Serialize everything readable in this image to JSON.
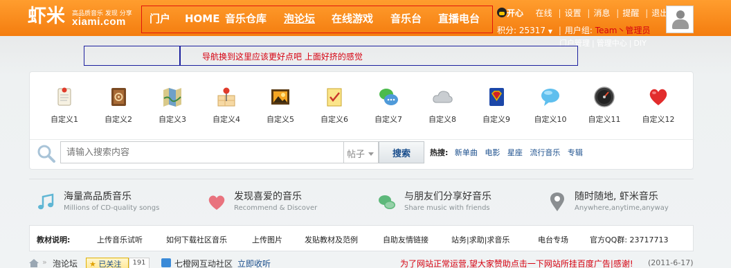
{
  "colors": {
    "brand_orange": "#f47d0f",
    "accent_red": "#e0140d",
    "link_blue": "#1a4e8c",
    "notice_red": "#d6000f"
  },
  "header": {
    "logo": {
      "main": "虾米",
      "tagline": "高品质音乐 发现 分享",
      "domain": "xiami.com"
    },
    "nav": [
      "门户",
      "HOME",
      "音乐仓库",
      "泡论坛",
      "在线游戏",
      "音乐台",
      "直播电台"
    ],
    "active_nav": "泡论坛",
    "user": {
      "name": "开心",
      "links": [
        "在线",
        "设置",
        "消息",
        "提醒",
        "退出"
      ],
      "score_label": "积分: 25317",
      "group_label": "用户组:",
      "group_value": "Team丶管理员"
    },
    "admin_links": [
      "门户管理",
      "管理中心",
      "DIY"
    ]
  },
  "notice": {
    "text": "导航换到这里应该更好点吧  上面好挤的感觉"
  },
  "icons": [
    {
      "label": "自定义1",
      "icon": "memo-pin-icon"
    },
    {
      "label": "自定义2",
      "icon": "address-book-icon"
    },
    {
      "label": "自定义3",
      "icon": "map-icon"
    },
    {
      "label": "自定义4",
      "icon": "map-pin-icon"
    },
    {
      "label": "自定义5",
      "icon": "picture-icon"
    },
    {
      "label": "自定义6",
      "icon": "checklist-icon"
    },
    {
      "label": "自定义7",
      "icon": "chat-bubbles-icon"
    },
    {
      "label": "自定义8",
      "icon": "cloud-icon"
    },
    {
      "label": "自定义9",
      "icon": "superman-book-icon"
    },
    {
      "label": "自定义10",
      "icon": "speech-bubble-icon"
    },
    {
      "label": "自定义11",
      "icon": "gauge-icon"
    },
    {
      "label": "自定义12",
      "icon": "heart-icon"
    }
  ],
  "search": {
    "placeholder": "请输入搜索内容",
    "type_selected": "帖子",
    "button": "搜索",
    "hot_label": "热搜:",
    "hot_links": [
      "新单曲",
      "电影",
      "星座",
      "流行音乐",
      "专辑"
    ]
  },
  "features": [
    {
      "title": "海量高品质音乐",
      "subtitle": "Millions of CD-quality songs",
      "icon": "music-note-icon",
      "color": "#5fb6d4"
    },
    {
      "title": "发现喜爱的音乐",
      "subtitle": "Recommend & Discover",
      "icon": "heart-icon",
      "color": "#e9737e"
    },
    {
      "title": "与朋友们分享好音乐",
      "subtitle": "Share music with friends",
      "icon": "chat-icon",
      "color": "#5db87a"
    },
    {
      "title": "随时随地, 虾米音乐",
      "subtitle": "Anywhere,anytime,anyway",
      "icon": "location-icon",
      "color": "#8a8e91"
    }
  ],
  "tutorial": {
    "label": "教材说明:",
    "links": [
      "上传音乐试听",
      "如何下载社区音乐",
      "上传图片",
      "发贴教材及范例",
      "自助友情链接",
      "站务|求助|求音乐",
      "电台专场",
      "官方QQ群: 23717713"
    ]
  },
  "bottom": {
    "breadcrumb_sep": "»",
    "breadcrumb": "泡论坛",
    "follow_label": "已关注",
    "follow_count": "191",
    "ext_site": "七橙网互动社区",
    "ext_link": "立即收听",
    "ad_text": "为了网站正常运营,望大家赞助点击一下网站所挂百度广告|感谢!",
    "ad_date": "(2011-6-17)"
  }
}
